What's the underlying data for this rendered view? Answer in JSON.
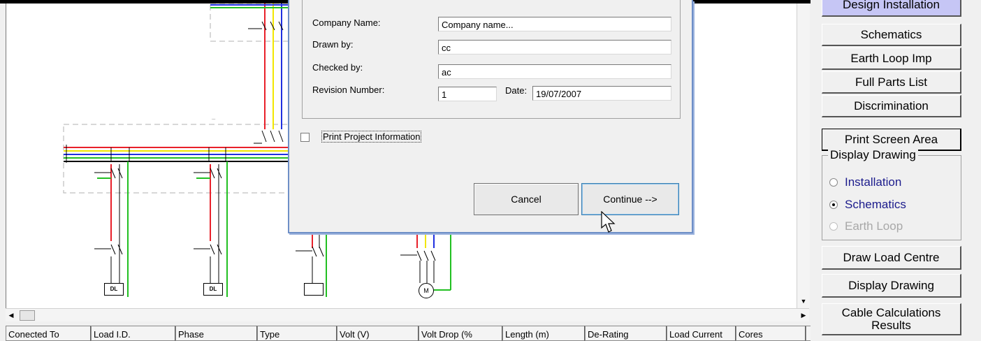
{
  "dialog": {
    "company_label": "Company Name:",
    "company_value": "Company name...",
    "drawn_label": "Drawn by:",
    "drawn_value": "cc",
    "checked_label": "Checked by:",
    "checked_value": "ac",
    "revision_label": "Revision Number:",
    "revision_value": "1",
    "date_label": "Date:",
    "date_value": "19/07/2007",
    "print_info_label": "Print Project Information",
    "print_info_checked": false,
    "cancel_label": "Cancel",
    "continue_label": "Continue -->"
  },
  "right_panel": {
    "top_button": "Design Installation",
    "top_button_color": "#c6c6f5",
    "schematics": "Schematics",
    "earth_loop_imp": "Earth Loop Imp",
    "full_parts_list": "Full Parts List",
    "discrimination": "Discrimination",
    "print_screen_area": "Print Screen Area",
    "display_drawing_group": "Display Drawing",
    "radios": [
      {
        "label": "Installation",
        "selected": false,
        "enabled": true
      },
      {
        "label": "Schematics",
        "selected": true,
        "enabled": true
      },
      {
        "label": "Earth Loop",
        "selected": false,
        "enabled": false
      }
    ],
    "draw_load_centre": "Draw Load Centre",
    "display_drawing_button": "Display Drawing",
    "cable_calc_results": "Cable Calculations Results"
  },
  "table": {
    "headers": [
      "Conected To",
      "Load I.D.",
      "Phase",
      "Type",
      "Volt (V)",
      "Volt Drop (%",
      "Length (m)",
      "De-Rating",
      "Load Current",
      "Cores"
    ]
  },
  "drawing": {
    "load_symbols": [
      "DL",
      "DL",
      "",
      "M"
    ],
    "wire_colors": {
      "red": "#e8202a",
      "yellow": "#f2e600",
      "blue": "#2030e0",
      "green": "#22c022",
      "black": "#000000"
    }
  },
  "icons": {
    "cursor": "arrow-pointer-icon",
    "scroll_up": "scroll-up-arrow-icon",
    "scroll_down": "scroll-down-arrow-icon",
    "scroll_left": "scroll-left-arrow-icon",
    "scroll_right": "scroll-right-arrow-icon"
  }
}
